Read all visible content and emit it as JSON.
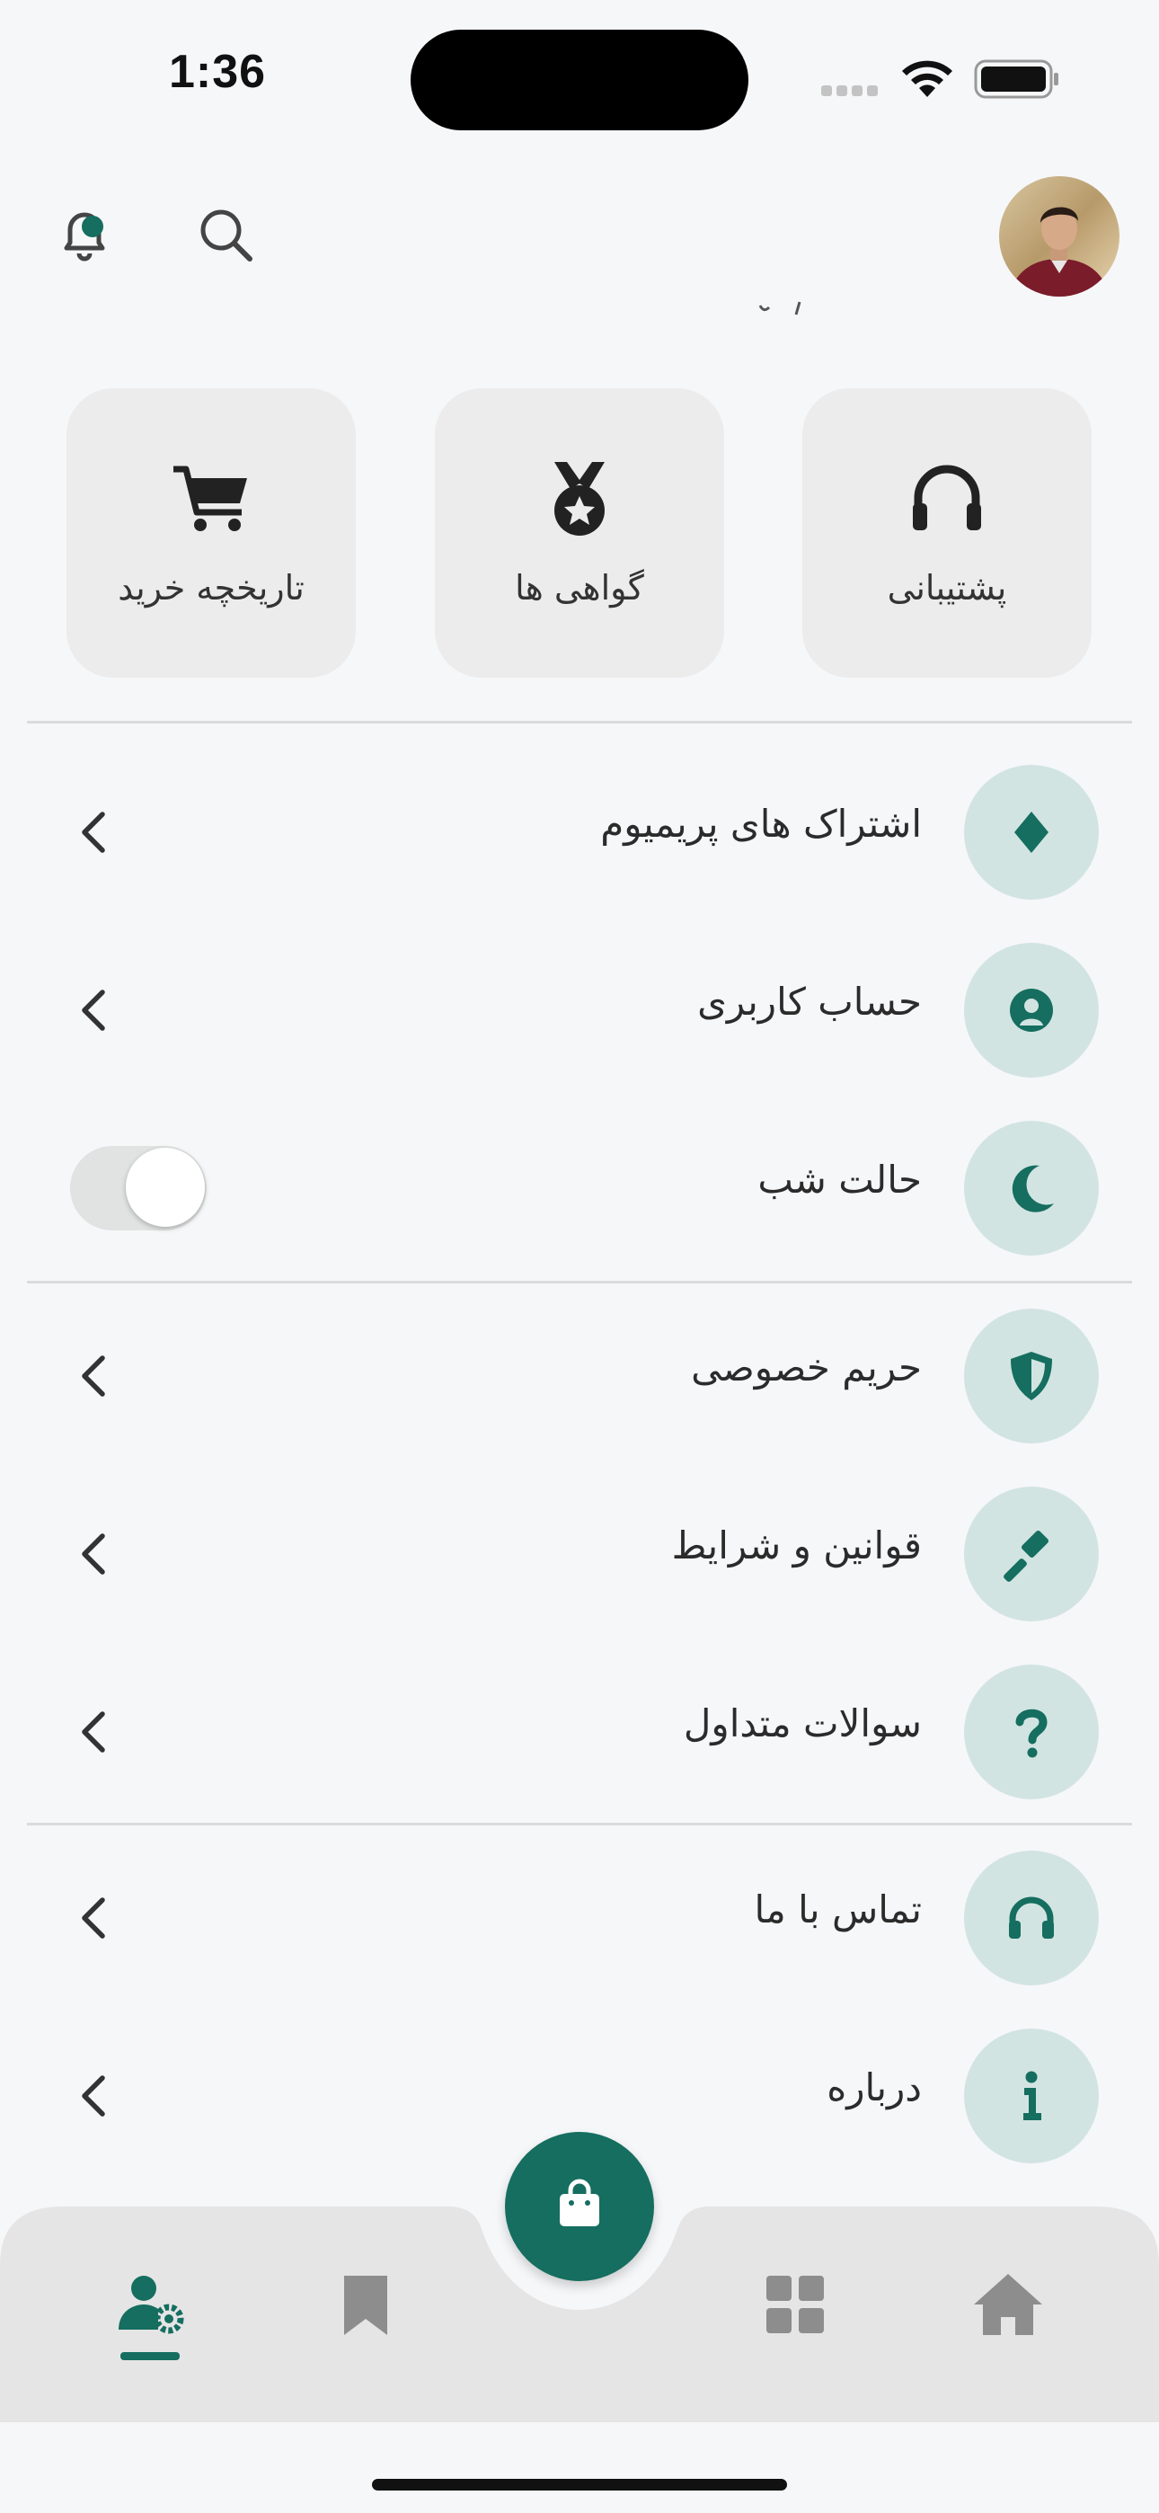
{
  "status_bar": {
    "time": "1:36"
  },
  "quick_actions": [
    {
      "label": "پشتیبانی",
      "icon": "headphones-icon"
    },
    {
      "label": "گواهی ها",
      "icon": "medal-icon"
    },
    {
      "label": "تاریخچه خرید",
      "icon": "cart-icon"
    }
  ],
  "menu": [
    {
      "label": "اشتراک های پریمیوم",
      "icon": "diamond-icon"
    },
    {
      "label": "حساب کاربری",
      "icon": "user-icon"
    },
    {
      "label": "حالت شب",
      "icon": "moon-icon",
      "toggle": false
    },
    {
      "label": "حریم خصوصی",
      "icon": "shield-icon"
    },
    {
      "label": "قوانین و شرایط",
      "icon": "gavel-icon"
    },
    {
      "label": "سوالات متداول",
      "icon": "question-icon"
    },
    {
      "label": "تماس با ما",
      "icon": "headset-icon"
    },
    {
      "label": "درباره",
      "icon": "info-icon"
    }
  ],
  "bottom_nav": {
    "active": "profile-settings",
    "items": [
      "profile-settings-icon",
      "bookmark-icon",
      "shop-bag-icon",
      "grid-icon",
      "home-icon"
    ]
  },
  "colors": {
    "accent": "#156e5f",
    "icon_bg": "#d2e4e2",
    "tile_bg": "#ececec",
    "nav_bg": "#e5e5e5"
  }
}
